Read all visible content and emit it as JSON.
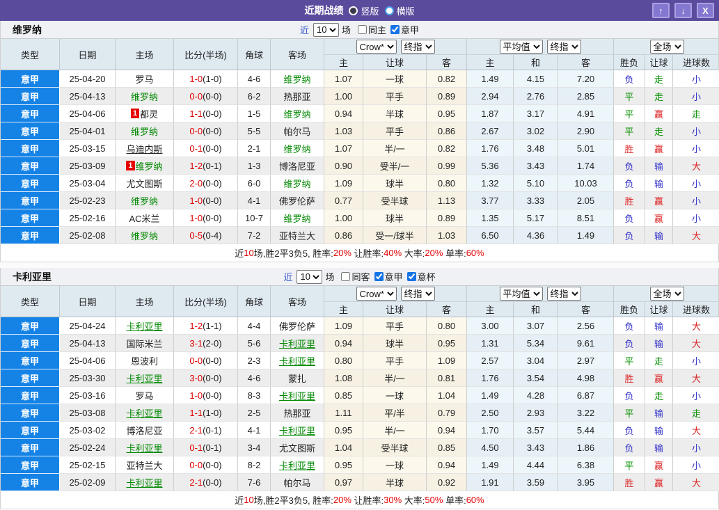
{
  "titlebar": {
    "title": "近期战绩",
    "radios": [
      {
        "label": "竖版",
        "checked": true
      },
      {
        "label": "横版",
        "checked": false
      }
    ],
    "buttons": {
      "up": "↑",
      "down": "↓",
      "close": "X"
    }
  },
  "colors": {
    "title_bar": "#5b4b9d",
    "league_cell_blue": "#1583e6",
    "score_red": "#e00000",
    "team_green": "#008800",
    "result_red": "#dd2222",
    "result_green": "#089000",
    "result_blue": "#3333cc"
  },
  "table_chrome": {
    "near_label": "近",
    "near_value": "10",
    "games_label": "场",
    "columns": [
      "类型",
      "日期",
      "主场",
      "比分(半场)",
      "角球",
      "客场"
    ],
    "subcolumns": [
      "主",
      "让球",
      "客",
      "主",
      "和",
      "客",
      "胜负",
      "让球",
      "进球数"
    ],
    "selects": {
      "odds_company": "Crow*",
      "odds_index": "终指",
      "average": "平均值",
      "average_index": "终指",
      "scope": "全场"
    }
  },
  "tables": [
    {
      "team": "维罗纳",
      "checkboxes": [
        {
          "label": "同主",
          "checked": false
        },
        {
          "label": "意甲",
          "checked": true
        }
      ],
      "rows": [
        {
          "league": "意甲",
          "date": "25-04-20",
          "home": {
            "name": "罗马",
            "green": false,
            "underline": false,
            "badge": ""
          },
          "score_ft": "1-0",
          "score_ht": "(1-0)",
          "corners": "4-6",
          "away": {
            "name": "维罗纳",
            "green": true,
            "underline": false,
            "badge": ""
          },
          "odds": [
            "1.07",
            "一球",
            "0.82"
          ],
          "avg": [
            "1.49",
            "4.15",
            "7.20"
          ],
          "results": [
            [
              "负",
              "b"
            ],
            [
              "走",
              "g"
            ],
            [
              "小",
              "b"
            ]
          ]
        },
        {
          "league": "意甲",
          "date": "25-04-13",
          "home": {
            "name": "维罗纳",
            "green": true,
            "underline": false,
            "badge": ""
          },
          "score_ft": "0-0",
          "score_ht": "(0-0)",
          "corners": "6-2",
          "away": {
            "name": "热那亚",
            "green": false,
            "underline": false,
            "badge": ""
          },
          "odds": [
            "1.00",
            "平手",
            "0.89"
          ],
          "avg": [
            "2.94",
            "2.76",
            "2.85"
          ],
          "results": [
            [
              "平",
              "g"
            ],
            [
              "走",
              "g"
            ],
            [
              "小",
              "b"
            ]
          ]
        },
        {
          "league": "意甲",
          "date": "25-04-06",
          "home": {
            "name": "都灵",
            "green": false,
            "underline": false,
            "badge": "1"
          },
          "score_ft": "1-1",
          "score_ht": "(0-0)",
          "corners": "1-5",
          "away": {
            "name": "维罗纳",
            "green": true,
            "underline": false,
            "badge": ""
          },
          "odds": [
            "0.94",
            "半球",
            "0.95"
          ],
          "avg": [
            "1.87",
            "3.17",
            "4.91"
          ],
          "results": [
            [
              "平",
              "g"
            ],
            [
              "赢",
              "r"
            ],
            [
              "走",
              "g"
            ]
          ]
        },
        {
          "league": "意甲",
          "date": "25-04-01",
          "home": {
            "name": "维罗纳",
            "green": true,
            "underline": false,
            "badge": ""
          },
          "score_ft": "0-0",
          "score_ht": "(0-0)",
          "corners": "5-5",
          "away": {
            "name": "帕尔马",
            "green": false,
            "underline": false,
            "badge": ""
          },
          "odds": [
            "1.03",
            "平手",
            "0.86"
          ],
          "avg": [
            "2.67",
            "3.02",
            "2.90"
          ],
          "results": [
            [
              "平",
              "g"
            ],
            [
              "走",
              "g"
            ],
            [
              "小",
              "b"
            ]
          ]
        },
        {
          "league": "意甲",
          "date": "25-03-15",
          "home": {
            "name": "乌迪内斯",
            "green": false,
            "underline": true,
            "badge": ""
          },
          "score_ft": "0-1",
          "score_ht": "(0-0)",
          "corners": "2-1",
          "away": {
            "name": "维罗纳",
            "green": true,
            "underline": false,
            "badge": ""
          },
          "odds": [
            "1.07",
            "半/一",
            "0.82"
          ],
          "avg": [
            "1.76",
            "3.48",
            "5.01"
          ],
          "results": [
            [
              "胜",
              "r"
            ],
            [
              "赢",
              "r"
            ],
            [
              "小",
              "b"
            ]
          ]
        },
        {
          "league": "意甲",
          "date": "25-03-09",
          "home": {
            "name": "维罗纳",
            "green": true,
            "underline": false,
            "badge": "1"
          },
          "score_ft": "1-2",
          "score_ht": "(0-1)",
          "corners": "1-3",
          "away": {
            "name": "博洛尼亚",
            "green": false,
            "underline": false,
            "badge": ""
          },
          "odds": [
            "0.90",
            "受半/一",
            "0.99"
          ],
          "avg": [
            "5.36",
            "3.43",
            "1.74"
          ],
          "results": [
            [
              "负",
              "b"
            ],
            [
              "输",
              "b"
            ],
            [
              "大",
              "r"
            ]
          ]
        },
        {
          "league": "意甲",
          "date": "25-03-04",
          "home": {
            "name": "尤文图斯",
            "green": false,
            "underline": false,
            "badge": ""
          },
          "score_ft": "2-0",
          "score_ht": "(0-0)",
          "corners": "6-0",
          "away": {
            "name": "维罗纳",
            "green": true,
            "underline": false,
            "badge": ""
          },
          "odds": [
            "1.09",
            "球半",
            "0.80"
          ],
          "avg": [
            "1.32",
            "5.10",
            "10.03"
          ],
          "results": [
            [
              "负",
              "b"
            ],
            [
              "输",
              "b"
            ],
            [
              "小",
              "b"
            ]
          ]
        },
        {
          "league": "意甲",
          "date": "25-02-23",
          "home": {
            "name": "维罗纳",
            "green": true,
            "underline": false,
            "badge": ""
          },
          "score_ft": "1-0",
          "score_ht": "(0-0)",
          "corners": "4-1",
          "away": {
            "name": "佛罗伦萨",
            "green": false,
            "underline": false,
            "badge": ""
          },
          "odds": [
            "0.77",
            "受半球",
            "1.13"
          ],
          "avg": [
            "3.77",
            "3.33",
            "2.05"
          ],
          "results": [
            [
              "胜",
              "r"
            ],
            [
              "赢",
              "r"
            ],
            [
              "小",
              "b"
            ]
          ]
        },
        {
          "league": "意甲",
          "date": "25-02-16",
          "home": {
            "name": "AC米兰",
            "green": false,
            "underline": false,
            "badge": ""
          },
          "score_ft": "1-0",
          "score_ht": "(0-0)",
          "corners": "10-7",
          "away": {
            "name": "维罗纳",
            "green": true,
            "underline": false,
            "badge": ""
          },
          "odds": [
            "1.00",
            "球半",
            "0.89"
          ],
          "avg": [
            "1.35",
            "5.17",
            "8.51"
          ],
          "results": [
            [
              "负",
              "b"
            ],
            [
              "赢",
              "r"
            ],
            [
              "小",
              "b"
            ]
          ]
        },
        {
          "league": "意甲",
          "date": "25-02-08",
          "home": {
            "name": "维罗纳",
            "green": true,
            "underline": false,
            "badge": ""
          },
          "score_ft": "0-5",
          "score_ht": "(0-4)",
          "corners": "7-2",
          "away": {
            "name": "亚特兰大",
            "green": false,
            "underline": false,
            "badge": ""
          },
          "odds": [
            "0.86",
            "受一/球半",
            "1.03"
          ],
          "avg": [
            "6.50",
            "4.36",
            "1.49"
          ],
          "results": [
            [
              "负",
              "b"
            ],
            [
              "输",
              "b"
            ],
            [
              "大",
              "r"
            ]
          ]
        }
      ],
      "summary": [
        [
          "近",
          "k"
        ],
        [
          "10",
          "r"
        ],
        [
          "场,胜2平3负5, 胜率:",
          "k"
        ],
        [
          "20%",
          "r"
        ],
        [
          " 让胜率:",
          "k"
        ],
        [
          "40%",
          "r"
        ],
        [
          " 大率:",
          "k"
        ],
        [
          "20%",
          "r"
        ],
        [
          " 单率:",
          "k"
        ],
        [
          "60%",
          "r"
        ]
      ]
    },
    {
      "team": "卡利亚里",
      "checkboxes": [
        {
          "label": "同客",
          "checked": false
        },
        {
          "label": "意甲",
          "checked": true
        },
        {
          "label": "意杯",
          "checked": true
        }
      ],
      "rows": [
        {
          "league": "意甲",
          "date": "25-04-24",
          "home": {
            "name": "卡利亚里",
            "green": true,
            "underline": true,
            "badge": ""
          },
          "score_ft": "1-2",
          "score_ht": "(1-1)",
          "corners": "4-4",
          "away": {
            "name": "佛罗伦萨",
            "green": false,
            "underline": false,
            "badge": ""
          },
          "odds": [
            "1.09",
            "平手",
            "0.80"
          ],
          "avg": [
            "3.00",
            "3.07",
            "2.56"
          ],
          "results": [
            [
              "负",
              "b"
            ],
            [
              "输",
              "b"
            ],
            [
              "大",
              "r"
            ]
          ]
        },
        {
          "league": "意甲",
          "date": "25-04-13",
          "home": {
            "name": "国际米兰",
            "green": false,
            "underline": false,
            "badge": ""
          },
          "score_ft": "3-1",
          "score_ht": "(2-0)",
          "corners": "5-6",
          "away": {
            "name": "卡利亚里",
            "green": true,
            "underline": true,
            "badge": ""
          },
          "odds": [
            "0.94",
            "球半",
            "0.95"
          ],
          "avg": [
            "1.31",
            "5.34",
            "9.61"
          ],
          "results": [
            [
              "负",
              "b"
            ],
            [
              "输",
              "b"
            ],
            [
              "大",
              "r"
            ]
          ]
        },
        {
          "league": "意甲",
          "date": "25-04-06",
          "home": {
            "name": "恩波利",
            "green": false,
            "underline": false,
            "badge": ""
          },
          "score_ft": "0-0",
          "score_ht": "(0-0)",
          "corners": "2-3",
          "away": {
            "name": "卡利亚里",
            "green": true,
            "underline": true,
            "badge": ""
          },
          "odds": [
            "0.80",
            "平手",
            "1.09"
          ],
          "avg": [
            "2.57",
            "3.04",
            "2.97"
          ],
          "results": [
            [
              "平",
              "g"
            ],
            [
              "走",
              "g"
            ],
            [
              "小",
              "b"
            ]
          ]
        },
        {
          "league": "意甲",
          "date": "25-03-30",
          "home": {
            "name": "卡利亚里",
            "green": true,
            "underline": true,
            "badge": ""
          },
          "score_ft": "3-0",
          "score_ht": "(0-0)",
          "corners": "4-6",
          "away": {
            "name": "蒙扎",
            "green": false,
            "underline": false,
            "badge": ""
          },
          "odds": [
            "1.08",
            "半/一",
            "0.81"
          ],
          "avg": [
            "1.76",
            "3.54",
            "4.98"
          ],
          "results": [
            [
              "胜",
              "r"
            ],
            [
              "赢",
              "r"
            ],
            [
              "大",
              "r"
            ]
          ]
        },
        {
          "league": "意甲",
          "date": "25-03-16",
          "home": {
            "name": "罗马",
            "green": false,
            "underline": false,
            "badge": ""
          },
          "score_ft": "1-0",
          "score_ht": "(0-0)",
          "corners": "8-3",
          "away": {
            "name": "卡利亚里",
            "green": true,
            "underline": true,
            "badge": ""
          },
          "odds": [
            "0.85",
            "一球",
            "1.04"
          ],
          "avg": [
            "1.49",
            "4.28",
            "6.87"
          ],
          "results": [
            [
              "负",
              "b"
            ],
            [
              "走",
              "g"
            ],
            [
              "小",
              "b"
            ]
          ]
        },
        {
          "league": "意甲",
          "date": "25-03-08",
          "home": {
            "name": "卡利亚里",
            "green": true,
            "underline": true,
            "badge": ""
          },
          "score_ft": "1-1",
          "score_ht": "(1-0)",
          "corners": "2-5",
          "away": {
            "name": "热那亚",
            "green": false,
            "underline": false,
            "badge": ""
          },
          "odds": [
            "1.11",
            "平/半",
            "0.79"
          ],
          "avg": [
            "2.50",
            "2.93",
            "3.22"
          ],
          "results": [
            [
              "平",
              "g"
            ],
            [
              "输",
              "b"
            ],
            [
              "走",
              "g"
            ]
          ]
        },
        {
          "league": "意甲",
          "date": "25-03-02",
          "home": {
            "name": "博洛尼亚",
            "green": false,
            "underline": false,
            "badge": ""
          },
          "score_ft": "2-1",
          "score_ht": "(0-1)",
          "corners": "4-1",
          "away": {
            "name": "卡利亚里",
            "green": true,
            "underline": true,
            "badge": ""
          },
          "odds": [
            "0.95",
            "半/一",
            "0.94"
          ],
          "avg": [
            "1.70",
            "3.57",
            "5.44"
          ],
          "results": [
            [
              "负",
              "b"
            ],
            [
              "输",
              "b"
            ],
            [
              "大",
              "r"
            ]
          ]
        },
        {
          "league": "意甲",
          "date": "25-02-24",
          "home": {
            "name": "卡利亚里",
            "green": true,
            "underline": true,
            "badge": ""
          },
          "score_ft": "0-1",
          "score_ht": "(0-1)",
          "corners": "3-4",
          "away": {
            "name": "尤文图斯",
            "green": false,
            "underline": false,
            "badge": ""
          },
          "odds": [
            "1.04",
            "受半球",
            "0.85"
          ],
          "avg": [
            "4.50",
            "3.43",
            "1.86"
          ],
          "results": [
            [
              "负",
              "b"
            ],
            [
              "输",
              "b"
            ],
            [
              "小",
              "b"
            ]
          ]
        },
        {
          "league": "意甲",
          "date": "25-02-15",
          "home": {
            "name": "亚特兰大",
            "green": false,
            "underline": false,
            "badge": ""
          },
          "score_ft": "0-0",
          "score_ht": "(0-0)",
          "corners": "8-2",
          "away": {
            "name": "卡利亚里",
            "green": true,
            "underline": true,
            "badge": ""
          },
          "odds": [
            "0.95",
            "一球",
            "0.94"
          ],
          "avg": [
            "1.49",
            "4.44",
            "6.38"
          ],
          "results": [
            [
              "平",
              "g"
            ],
            [
              "赢",
              "r"
            ],
            [
              "小",
              "b"
            ]
          ]
        },
        {
          "league": "意甲",
          "date": "25-02-09",
          "home": {
            "name": "卡利亚里",
            "green": true,
            "underline": true,
            "badge": ""
          },
          "score_ft": "2-1",
          "score_ht": "(0-0)",
          "corners": "7-6",
          "away": {
            "name": "帕尔马",
            "green": false,
            "underline": false,
            "badge": ""
          },
          "odds": [
            "0.97",
            "半球",
            "0.92"
          ],
          "avg": [
            "1.91",
            "3.59",
            "3.95"
          ],
          "results": [
            [
              "胜",
              "r"
            ],
            [
              "赢",
              "r"
            ],
            [
              "大",
              "r"
            ]
          ]
        }
      ],
      "summary": [
        [
          "近",
          "k"
        ],
        [
          "10",
          "r"
        ],
        [
          "场,胜2平3负5, 胜率:",
          "k"
        ],
        [
          "20%",
          "r"
        ],
        [
          " 让胜率:",
          "k"
        ],
        [
          "30%",
          "r"
        ],
        [
          " 大率:",
          "k"
        ],
        [
          "50%",
          "r"
        ],
        [
          " 单率:",
          "k"
        ],
        [
          "60%",
          "r"
        ]
      ]
    }
  ]
}
